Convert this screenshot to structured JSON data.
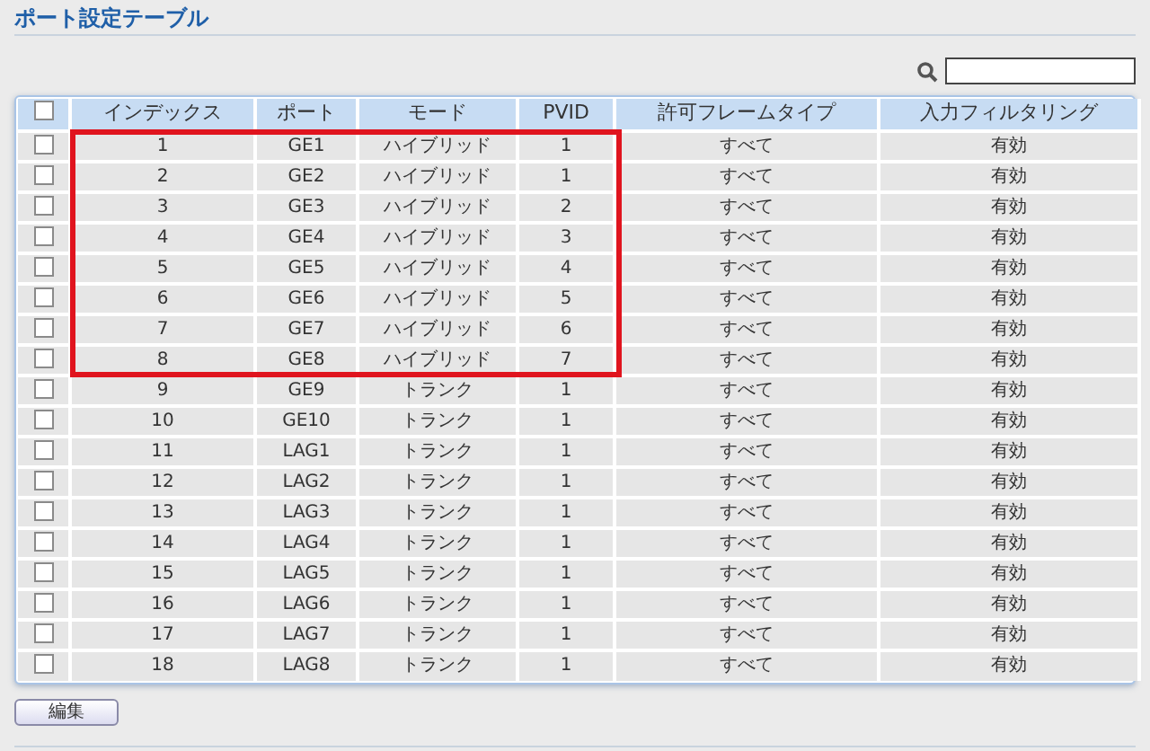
{
  "title": "ポート設定テーブル",
  "table": {
    "header_checked": false,
    "columns": [
      "インデックス",
      "ポート",
      "モード",
      "PVID",
      "許可フレームタイプ",
      "入力フィルタリング"
    ],
    "rows": [
      {
        "checked": false,
        "highlighted": true,
        "cells": [
          "1",
          "GE1",
          "ハイブリッド",
          "1",
          "すべて",
          "有効"
        ]
      },
      {
        "checked": false,
        "highlighted": true,
        "cells": [
          "2",
          "GE2",
          "ハイブリッド",
          "1",
          "すべて",
          "有効"
        ]
      },
      {
        "checked": false,
        "highlighted": true,
        "cells": [
          "3",
          "GE3",
          "ハイブリッド",
          "2",
          "すべて",
          "有効"
        ]
      },
      {
        "checked": false,
        "highlighted": true,
        "cells": [
          "4",
          "GE4",
          "ハイブリッド",
          "3",
          "すべて",
          "有効"
        ]
      },
      {
        "checked": false,
        "highlighted": true,
        "cells": [
          "5",
          "GE5",
          "ハイブリッド",
          "4",
          "すべて",
          "有効"
        ]
      },
      {
        "checked": false,
        "highlighted": true,
        "cells": [
          "6",
          "GE6",
          "ハイブリッド",
          "5",
          "すべて",
          "有効"
        ]
      },
      {
        "checked": false,
        "highlighted": true,
        "cells": [
          "7",
          "GE7",
          "ハイブリッド",
          "6",
          "すべて",
          "有効"
        ]
      },
      {
        "checked": false,
        "highlighted": true,
        "cells": [
          "8",
          "GE8",
          "ハイブリッド",
          "7",
          "すべて",
          "有効"
        ]
      },
      {
        "checked": false,
        "highlighted": false,
        "cells": [
          "9",
          "GE9",
          "トランク",
          "1",
          "すべて",
          "有効"
        ]
      },
      {
        "checked": false,
        "highlighted": false,
        "cells": [
          "10",
          "GE10",
          "トランク",
          "1",
          "すべて",
          "有効"
        ]
      },
      {
        "checked": false,
        "highlighted": false,
        "cells": [
          "11",
          "LAG1",
          "トランク",
          "1",
          "すべて",
          "有効"
        ]
      },
      {
        "checked": false,
        "highlighted": false,
        "cells": [
          "12",
          "LAG2",
          "トランク",
          "1",
          "すべて",
          "有効"
        ]
      },
      {
        "checked": false,
        "highlighted": false,
        "cells": [
          "13",
          "LAG3",
          "トランク",
          "1",
          "すべて",
          "有効"
        ]
      },
      {
        "checked": false,
        "highlighted": false,
        "cells": [
          "14",
          "LAG4",
          "トランク",
          "1",
          "すべて",
          "有効"
        ]
      },
      {
        "checked": false,
        "highlighted": false,
        "cells": [
          "15",
          "LAG5",
          "トランク",
          "1",
          "すべて",
          "有効"
        ]
      },
      {
        "checked": false,
        "highlighted": false,
        "cells": [
          "16",
          "LAG6",
          "トランク",
          "1",
          "すべて",
          "有効"
        ]
      },
      {
        "checked": false,
        "highlighted": false,
        "cells": [
          "17",
          "LAG7",
          "トランク",
          "1",
          "すべて",
          "有効"
        ]
      },
      {
        "checked": false,
        "highlighted": false,
        "cells": [
          "18",
          "LAG8",
          "トランク",
          "1",
          "すべて",
          "有効"
        ]
      }
    ]
  },
  "button": "編集"
}
